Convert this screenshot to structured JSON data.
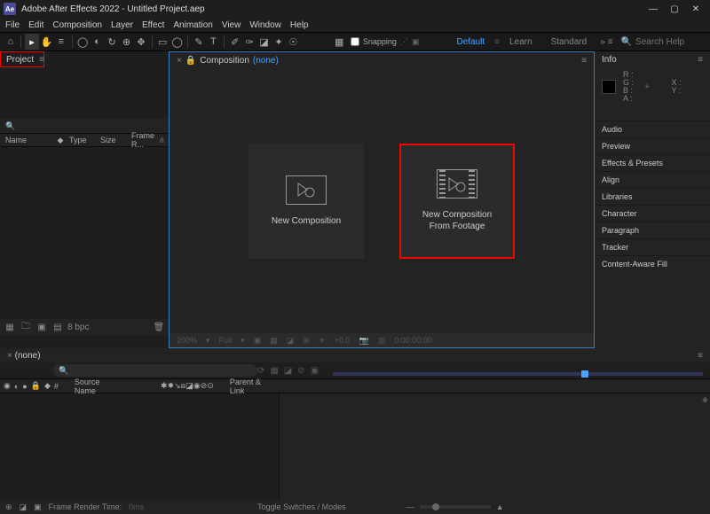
{
  "title": "Adobe After Effects 2022 - Untitled Project.aep",
  "app_icon": "Ae",
  "menu": [
    "File",
    "Edit",
    "Composition",
    "Layer",
    "Effect",
    "Animation",
    "View",
    "Window",
    "Help"
  ],
  "toolbar": {
    "snapping": "Snapping"
  },
  "workspaces": {
    "default": "Default",
    "learn": "Learn",
    "standard": "Standard"
  },
  "search_placeholder": "Search Help",
  "project_panel": {
    "label": "Project"
  },
  "project_cols": {
    "name": "Name",
    "type": "Type",
    "size": "Size",
    "frame": "Frame R..."
  },
  "bpc": "8 bpc",
  "comp_tab": {
    "label": "Composition",
    "value": "(none)"
  },
  "cards": {
    "new_comp": "New Composition",
    "new_from": "New Composition\nFrom Footage"
  },
  "center_foot": {
    "zoom": "200%",
    "full": "Full",
    "time": "0:00:00:00"
  },
  "info_panel": {
    "label": "Info",
    "r": "R :",
    "g": "G :",
    "b": "B :",
    "a": "A :",
    "x": "X :",
    "y": "Y :"
  },
  "right_panels": [
    "Audio",
    "Preview",
    "Effects & Presets",
    "Align",
    "Libraries",
    "Character",
    "Paragraph",
    "Tracker",
    "Content-Aware Fill"
  ],
  "tl_tab": "(none)",
  "tl_cols": {
    "source": "Source Name",
    "parent": "Parent & Link"
  },
  "status": {
    "frt": "Frame Render Time:",
    "frt_val": "0ms",
    "switches": "Toggle Switches / Modes"
  }
}
